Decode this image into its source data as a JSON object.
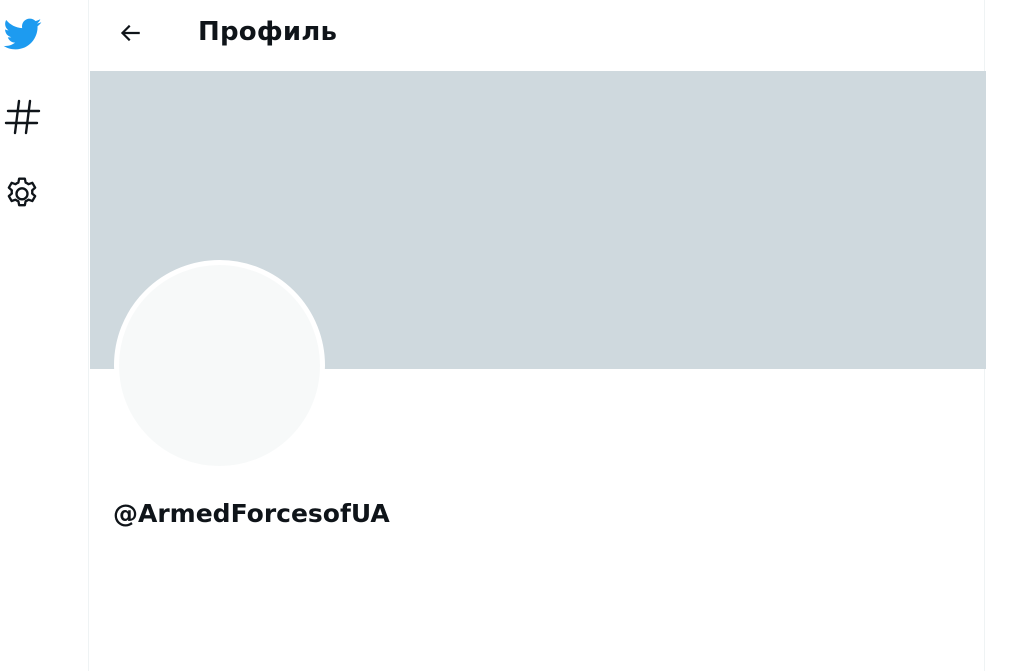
{
  "nav": {
    "items": [
      {
        "icon": "twitter-bird-icon",
        "color": "#1d9bf0"
      },
      {
        "icon": "hashtag-icon"
      },
      {
        "icon": "gear-icon"
      }
    ]
  },
  "header": {
    "back_icon": "arrow-left-icon",
    "title": "Профиль"
  },
  "profile": {
    "banner_color": "#cfd9de",
    "avatar_color": "#f7f9f9",
    "handle": "@ArmedForcesofUA"
  }
}
